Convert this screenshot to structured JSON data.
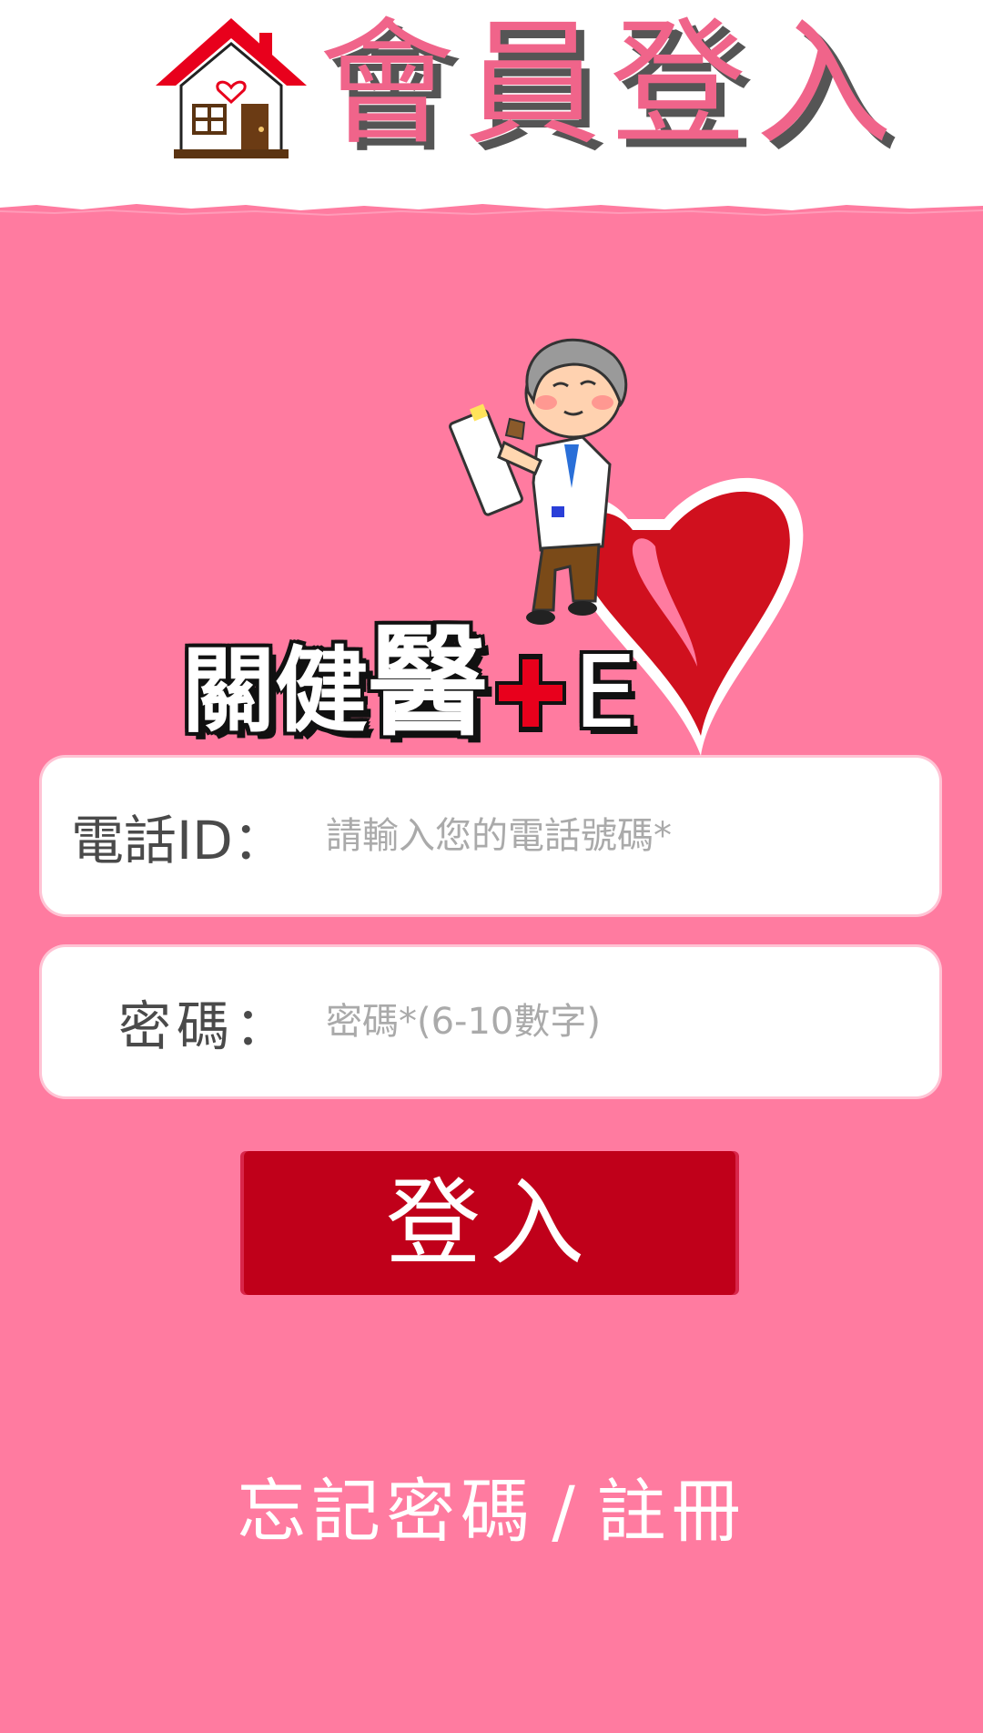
{
  "header": {
    "title": "會員登入",
    "icon": "home-icon"
  },
  "brand": {
    "name_main": "關健",
    "name_yi": "醫",
    "name_suffix": "E",
    "plus_icon": "red-plus-icon",
    "illustration": "doctor-heart-illustration"
  },
  "form": {
    "phone": {
      "label": "電話ID：",
      "placeholder": "請輸入您的電話號碼*",
      "value": ""
    },
    "password": {
      "label": "密碼：",
      "placeholder": "密碼*(6-10數字)",
      "value": ""
    }
  },
  "login_button": {
    "label": "登入"
  },
  "footer": {
    "forgot_password": "忘記密碼",
    "separator": "/",
    "register": "註冊"
  },
  "colors": {
    "background": "#ff7ba0",
    "header_bg": "#ffffff",
    "title_pink": "#f0648a",
    "button_red": "#c0001a",
    "field_bg": "#ffffff",
    "placeholder": "#aaaaaa"
  }
}
